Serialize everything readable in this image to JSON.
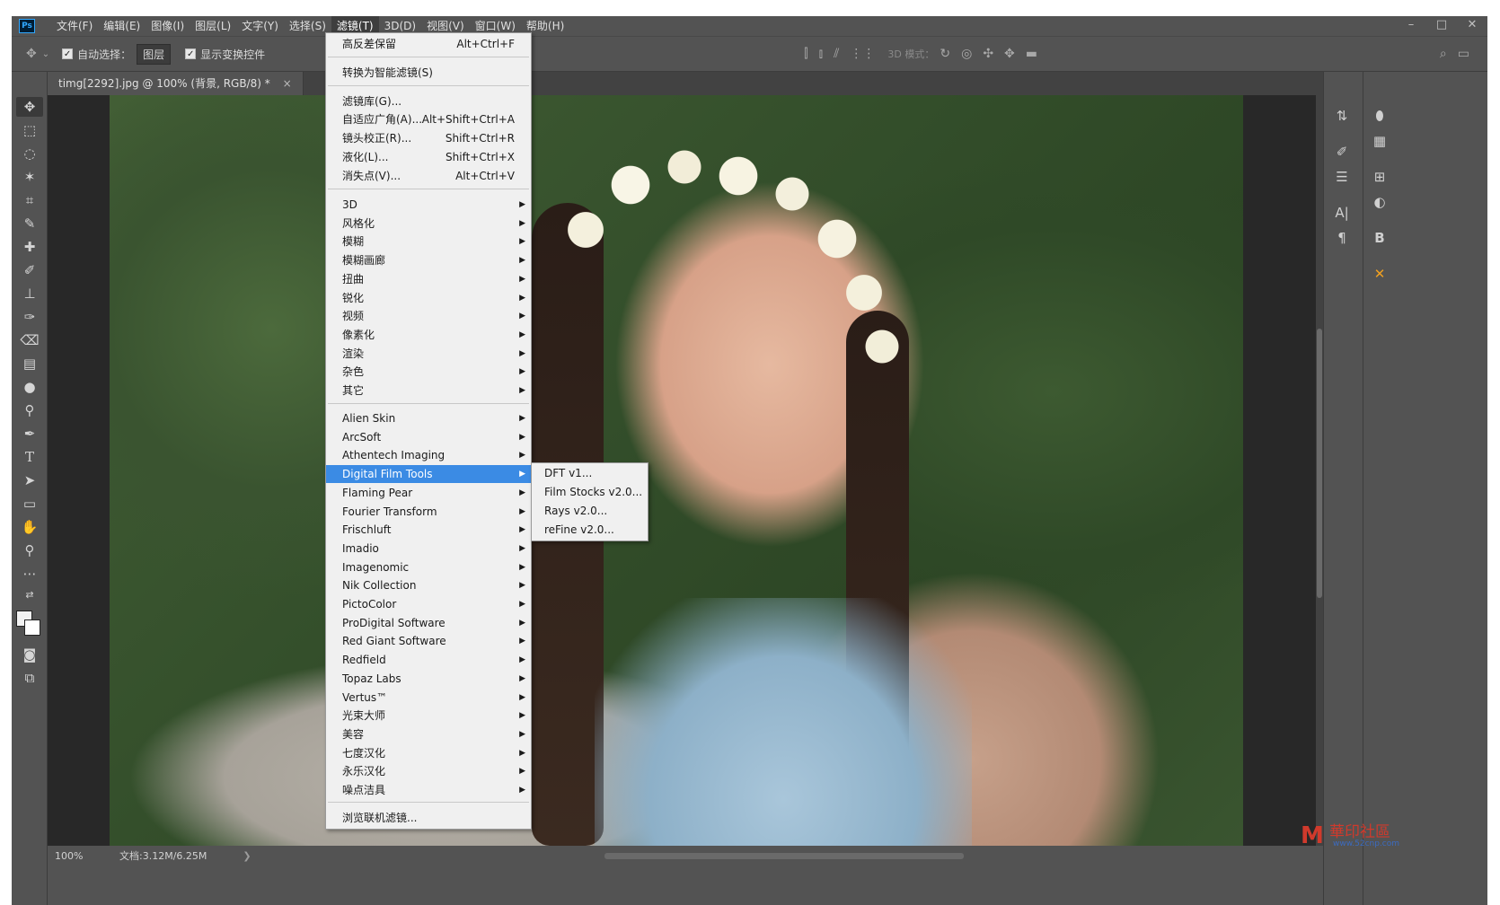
{
  "menubar": {
    "logo": "Ps",
    "items": [
      "文件(F)",
      "编辑(E)",
      "图像(I)",
      "图层(L)",
      "文字(Y)",
      "选择(S)",
      "滤镜(T)",
      "3D(D)",
      "视图(V)",
      "窗口(W)",
      "帮助(H)"
    ],
    "active_index": 6,
    "window_controls": [
      "–",
      "□",
      "✕"
    ]
  },
  "options": {
    "auto_select_label": "自动选择：",
    "auto_select_value": "图层",
    "show_transform_label": "显示变换控件",
    "mode_3d_label": "3D 模式："
  },
  "document": {
    "tab_title": "timg[2292].jpg @ 100% (背景, RGB/8) *",
    "close_glyph": "×"
  },
  "status": {
    "zoom": "100%",
    "doc_info": "文档:3.12M/6.25M",
    "arrow": "❯"
  },
  "filter_menu": {
    "top_items": [
      {
        "label": "高反差保留",
        "shortcut": "Alt+Ctrl+F"
      },
      {
        "label": "转换为智能滤镜(S)",
        "shortcut": ""
      }
    ],
    "gallery_items": [
      {
        "label": "滤镜库(G)...",
        "shortcut": ""
      },
      {
        "label": "自适应广角(A)...",
        "shortcut": "Alt+Shift+Ctrl+A"
      },
      {
        "label": "镜头校正(R)...",
        "shortcut": "Shift+Ctrl+R"
      },
      {
        "label": "液化(L)...",
        "shortcut": "Shift+Ctrl+X"
      },
      {
        "label": "消失点(V)...",
        "shortcut": "Alt+Ctrl+V"
      }
    ],
    "builtin_submenus": [
      "3D",
      "风格化",
      "模糊",
      "模糊画廊",
      "扭曲",
      "锐化",
      "视频",
      "像素化",
      "渲染",
      "杂色",
      "其它"
    ],
    "plugin_submenus": [
      "Alien Skin",
      "ArcSoft",
      "Athentech Imaging",
      "Digital Film Tools",
      "Flaming Pear",
      "Fourier Transform",
      "Frischluft",
      "Imadio",
      "Imagenomic",
      "Nik Collection",
      "PictoColor",
      "ProDigital Software",
      "Red Giant Software",
      "Redfield",
      "Topaz Labs",
      "Vertus™",
      "光束大师",
      "美容",
      "七度汉化",
      "永乐汉化",
      "噪点洁具"
    ],
    "highlighted": "Digital Film Tools",
    "bottom_item": "浏览联机滤镜..."
  },
  "submenu": {
    "items": [
      "DFT v1...",
      "Film Stocks v2.0...",
      "Rays v2.0...",
      "reFine v2.0..."
    ]
  },
  "watermark": {
    "text": "華印社區",
    "url": "www.52cnp.com"
  },
  "colors": {
    "ui_bg": "#535353",
    "menu_bg": "#f0f0f0",
    "highlight": "#3b8be4",
    "watermark": "#d03a2c"
  }
}
